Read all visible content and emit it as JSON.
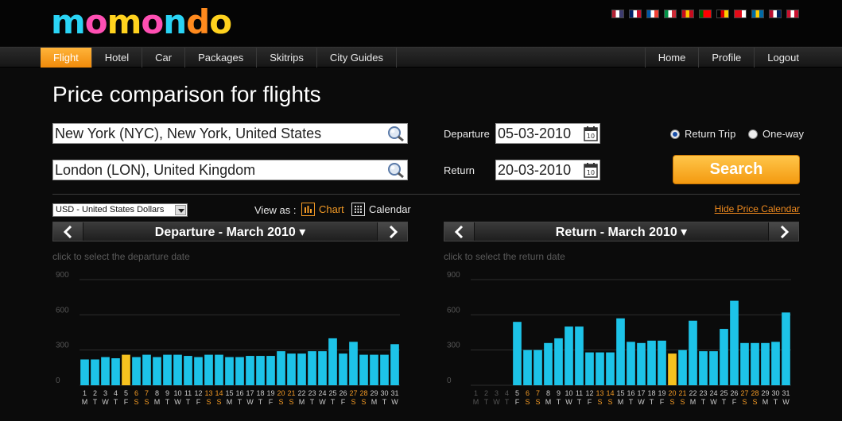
{
  "logo": {
    "letters": [
      "m",
      "o",
      "m",
      "o",
      "n",
      "d",
      "o"
    ],
    "colors": [
      "#2ad4f5",
      "#ff4fb3",
      "#ffd21e",
      "#ff4fb3",
      "#2ad4f5",
      "#ff8a1e",
      "#ffd21e"
    ]
  },
  "flags": [
    {
      "name": "us-flag-icon",
      "colors": [
        "#b22234",
        "#ffffff",
        "#3c3b6e"
      ]
    },
    {
      "name": "uk-flag-icon",
      "colors": [
        "#012169",
        "#ffffff",
        "#c8102e"
      ]
    },
    {
      "name": "fr-flag-icon",
      "colors": [
        "#0055a4",
        "#ffffff",
        "#ef4135"
      ]
    },
    {
      "name": "it-flag-icon",
      "colors": [
        "#009246",
        "#ffffff",
        "#ce2b37"
      ]
    },
    {
      "name": "es-flag-icon",
      "colors": [
        "#c60b1e",
        "#ffc400",
        "#c60b1e"
      ]
    },
    {
      "name": "pt-flag-icon",
      "colors": [
        "#006600",
        "#ff0000",
        "#ff0000"
      ]
    },
    {
      "name": "de-flag-icon",
      "colors": [
        "#000000",
        "#dd0000",
        "#ffce00"
      ]
    },
    {
      "name": "tr-flag-icon",
      "colors": [
        "#e30a17",
        "#e30a17",
        "#ffffff"
      ]
    },
    {
      "name": "se-flag-icon",
      "colors": [
        "#006aa7",
        "#fecc00",
        "#006aa7"
      ]
    },
    {
      "name": "no-flag-icon",
      "colors": [
        "#ba0c2f",
        "#ffffff",
        "#00205b"
      ]
    },
    {
      "name": "dk-flag-icon",
      "colors": [
        "#c8102e",
        "#ffffff",
        "#c8102e"
      ]
    }
  ],
  "nav": {
    "left": [
      "Flight",
      "Hotel",
      "Car",
      "Packages",
      "Skitrips",
      "City Guides"
    ],
    "right": [
      "Home",
      "Profile",
      "Logout"
    ],
    "active": "Flight"
  },
  "title": "Price comparison for flights",
  "form": {
    "from_value": "New York (NYC), New York, United States",
    "to_value": "London (LON), United Kingdom",
    "departure_label": "Departure",
    "departure_value": "05-03-2010",
    "return_label": "Return",
    "return_value": "20-03-2010",
    "return_trip_label": "Return Trip",
    "one_way_label": "One-way",
    "search_label": "Search"
  },
  "currency": "USD - United States Dollars",
  "view_as_label": "View as :",
  "view_chart_label": "Chart",
  "view_calendar_label": "Calendar",
  "hide_link": "Hide Price Calendar",
  "departure_header": "Departure - March 2010 ▾",
  "return_header": "Return - March 2010 ▾",
  "departure_hint": "click to select the departure date",
  "return_hint": "click to select the return date",
  "colors": {
    "bar": "#1dc3e8",
    "bar_selected": "#f7c21f",
    "weekend": "#f39a25",
    "weekday": "#cccccc",
    "disabled": "#555555"
  },
  "chart_data": [
    {
      "type": "bar",
      "title": "Departure - March 2010",
      "ylim": [
        0,
        900
      ],
      "yticks": [
        0,
        300,
        600,
        900
      ],
      "categories": [
        "1",
        "2",
        "3",
        "4",
        "5",
        "6",
        "7",
        "8",
        "9",
        "10",
        "11",
        "12",
        "13",
        "14",
        "15",
        "16",
        "17",
        "18",
        "19",
        "20",
        "21",
        "22",
        "23",
        "24",
        "25",
        "26",
        "27",
        "28",
        "29",
        "30",
        "31"
      ],
      "weekdays": [
        "M",
        "T",
        "W",
        "T",
        "F",
        "S",
        "S",
        "M",
        "T",
        "W",
        "T",
        "F",
        "S",
        "S",
        "M",
        "T",
        "W",
        "T",
        "F",
        "S",
        "S",
        "M",
        "T",
        "W",
        "T",
        "F",
        "S",
        "S",
        "M",
        "T",
        "W"
      ],
      "values": [
        220,
        220,
        240,
        230,
        260,
        240,
        260,
        240,
        260,
        260,
        250,
        240,
        260,
        260,
        240,
        240,
        250,
        250,
        250,
        290,
        270,
        270,
        290,
        290,
        400,
        270,
        370,
        260,
        260,
        260,
        350
      ],
      "selected": "5",
      "disabled": []
    },
    {
      "type": "bar",
      "title": "Return - March 2010",
      "ylim": [
        0,
        900
      ],
      "yticks": [
        0,
        300,
        600,
        900
      ],
      "categories": [
        "1",
        "2",
        "3",
        "4",
        "5",
        "6",
        "7",
        "8",
        "9",
        "10",
        "11",
        "12",
        "13",
        "14",
        "15",
        "16",
        "17",
        "18",
        "19",
        "20",
        "21",
        "22",
        "23",
        "24",
        "25",
        "26",
        "27",
        "28",
        "29",
        "30",
        "31"
      ],
      "weekdays": [
        "M",
        "T",
        "W",
        "T",
        "F",
        "S",
        "S",
        "M",
        "T",
        "W",
        "T",
        "F",
        "S",
        "S",
        "M",
        "T",
        "W",
        "T",
        "F",
        "S",
        "S",
        "M",
        "T",
        "W",
        "T",
        "F",
        "S",
        "S",
        "M",
        "T",
        "W"
      ],
      "values": [
        0,
        0,
        0,
        0,
        540,
        300,
        300,
        360,
        400,
        500,
        500,
        280,
        280,
        280,
        570,
        370,
        360,
        380,
        380,
        270,
        300,
        550,
        290,
        290,
        480,
        720,
        360,
        360,
        360,
        370,
        620
      ],
      "selected": "20",
      "disabled": [
        "1",
        "2",
        "3",
        "4"
      ]
    }
  ]
}
